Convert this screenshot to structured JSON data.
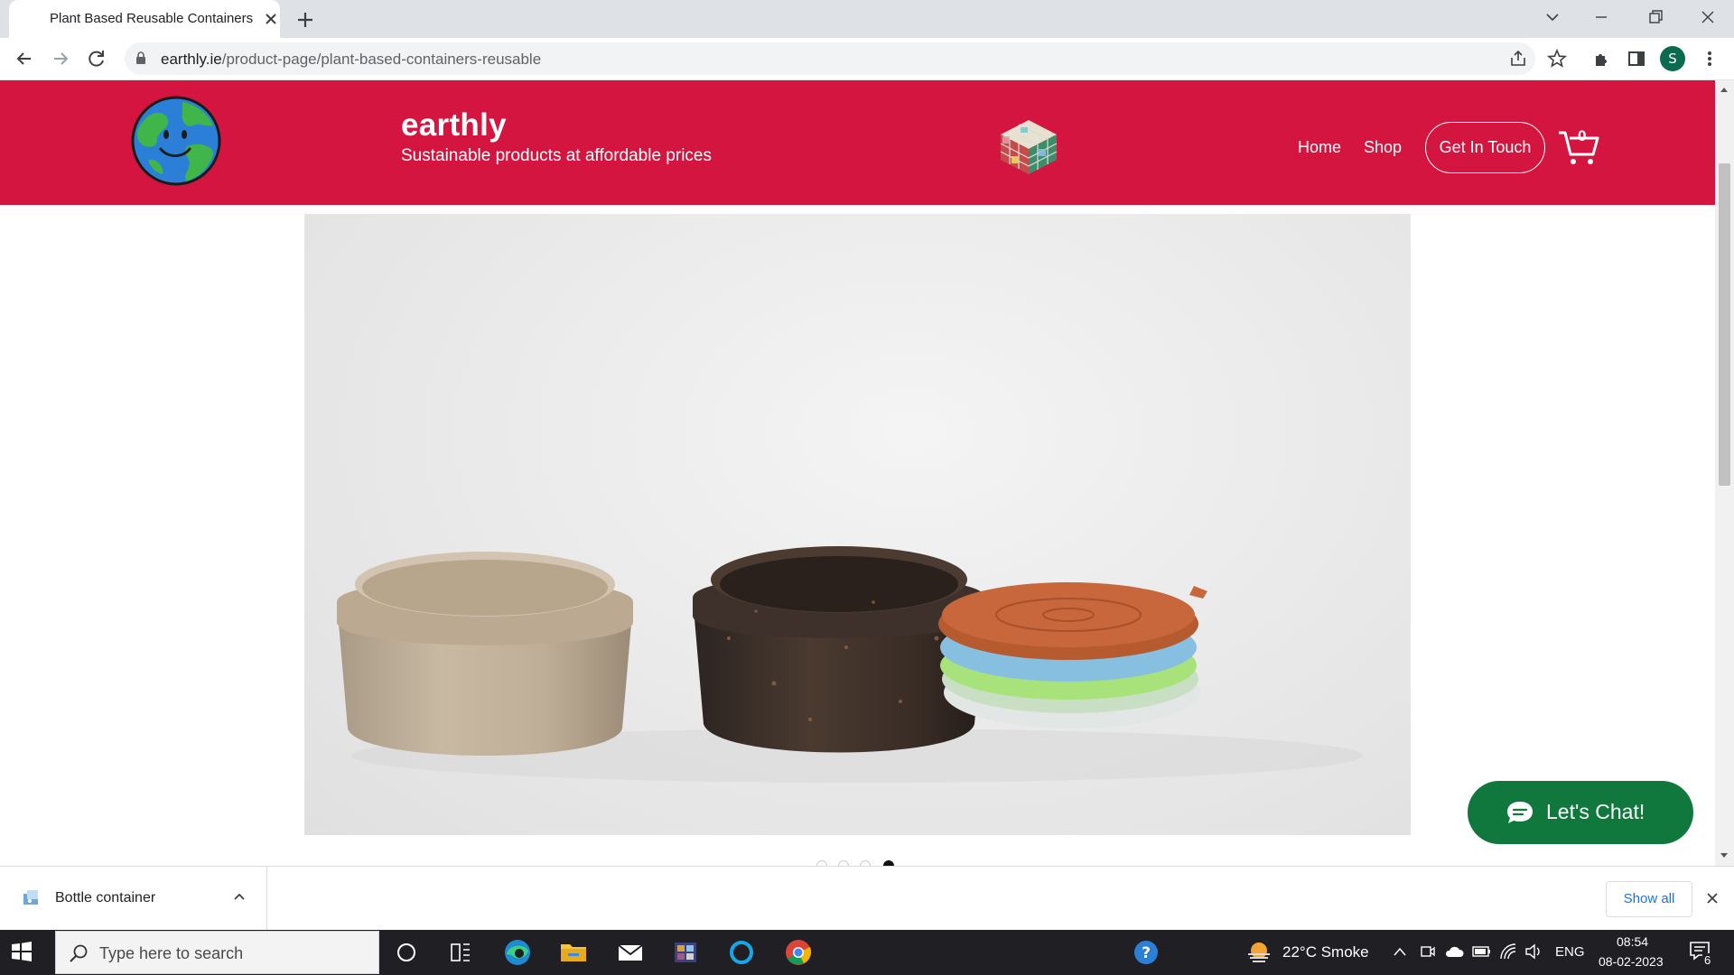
{
  "browser": {
    "tab_title": "Plant Based Reusable Containers",
    "url_host": "earthly.ie",
    "url_path": "/product-page/plant-based-containers-reusable",
    "profile_initial": "S"
  },
  "site": {
    "brand_name": "earthly",
    "tagline": "Sustainable products at affordable prices",
    "nav": {
      "home": "Home",
      "shop": "Shop",
      "contact": "Get In Touch"
    },
    "cart_count": "0",
    "carousel": {
      "slide_count": 4,
      "active_index": 3
    },
    "chat_label": "Let's Chat!",
    "colors": {
      "header": "#d4153f",
      "chat": "#10783c"
    }
  },
  "downloads": {
    "item_name": "Bottle container",
    "show_all": "Show all"
  },
  "taskbar": {
    "search_placeholder": "Type here to search",
    "weather": "22°C  Smoke",
    "language": "ENG",
    "time": "08:54",
    "date": "08-02-2023",
    "notifications": "6"
  }
}
